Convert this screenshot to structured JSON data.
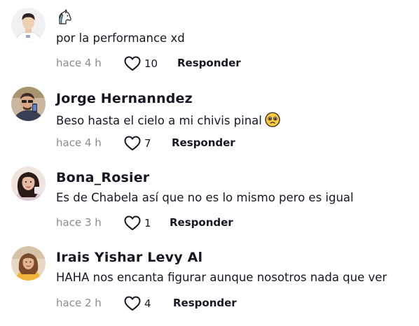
{
  "comments": [
    {
      "username": "",
      "username_emoji": "unicorn-icon",
      "text": "por la performance xd",
      "time": "hace 4 h",
      "likes": "10",
      "reply_label": "Responder"
    },
    {
      "username": "Jorge Hernanndez",
      "text": "Beso hasta el cielo a mi chivis pinal",
      "text_emoji": "pleading-face-icon",
      "time": "hace 4 h",
      "likes": "7",
      "reply_label": "Responder"
    },
    {
      "username": "Bona_Rosier",
      "text": "Es de Chabela así que no es lo mismo pero es igual",
      "time": "hace 3 h",
      "likes": "1",
      "reply_label": "Responder"
    },
    {
      "username": "Irais Yishar Levy Al",
      "text": "HAHA nos encanta figurar aunque nosotros nada que ver",
      "time": "hace 2 h",
      "likes": "4",
      "reply_label": "Responder"
    }
  ],
  "colors": {
    "text_primary": "#161823",
    "text_secondary": "#8a8b91",
    "background": "#ffffff"
  }
}
